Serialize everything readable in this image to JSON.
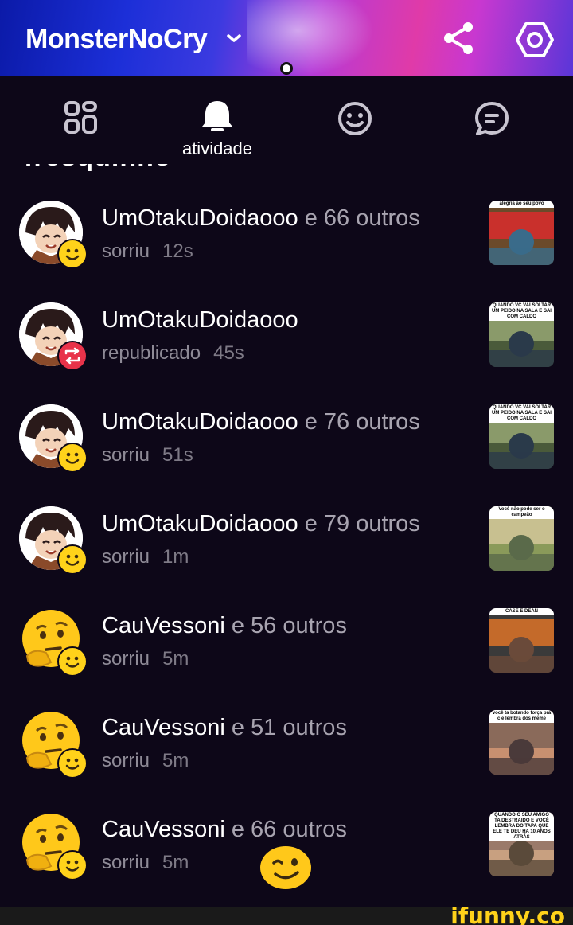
{
  "header": {
    "title": "MonsterNoCry",
    "chevron_icon": "chevron-down-icon",
    "share_icon": "share-icon",
    "settings_icon": "hexagon-settings-icon"
  },
  "tabs": [
    {
      "name": "tab-grid",
      "icon": "grid-icon",
      "label": ""
    },
    {
      "name": "tab-activity",
      "icon": "bell-icon",
      "label": "atividade"
    },
    {
      "name": "tab-smile",
      "icon": "smile-icon",
      "label": ""
    },
    {
      "name": "tab-chat",
      "icon": "chat-icon",
      "label": ""
    }
  ],
  "clipped_section_title": "fresquinho",
  "activity": [
    {
      "user": "UmOtakuDoidaooo",
      "others": " e 66 outros",
      "action": "sorriu",
      "time": "12s",
      "avatar": "anime",
      "badge": "smile",
      "thumb_caption": "alegria ao seu povo"
    },
    {
      "user": "UmOtakuDoidaooo",
      "others": "",
      "action": "republicado",
      "time": "45s",
      "avatar": "anime",
      "badge": "repost",
      "thumb_caption": "QUANDO VC VAI SOLTAR UM PEIDO NA SALA E SAI COM CALDO"
    },
    {
      "user": "UmOtakuDoidaooo",
      "others": " e 76 outros",
      "action": "sorriu",
      "time": "51s",
      "avatar": "anime",
      "badge": "smile",
      "thumb_caption": "QUANDO VC VAI SOLTAR UM PEIDO NA SALA E SAI COM CALDO"
    },
    {
      "user": "UmOtakuDoidaooo",
      "others": " e 79 outros",
      "action": "sorriu",
      "time": "1m",
      "avatar": "anime",
      "badge": "smile",
      "thumb_caption": "Você não pode ser o campeão"
    },
    {
      "user": "CauVessoni",
      "others": " e 56 outros",
      "action": "sorriu",
      "time": "5m",
      "avatar": "thinking",
      "badge": "smile",
      "thumb_caption": "CASE E DEAN"
    },
    {
      "user": "CauVessoni",
      "others": " e 51 outros",
      "action": "sorriu",
      "time": "5m",
      "avatar": "thinking",
      "badge": "smile",
      "thumb_caption": "você ta botando força pra c e lembra dos meme"
    },
    {
      "user": "CauVessoni",
      "others": " e 66 outros",
      "action": "sorriu",
      "time": "5m",
      "avatar": "thinking",
      "badge": "smile",
      "thumb_caption": "QUANDO O SEU AMIGO TA DESTRAIDO E VOCÊ LEMBRA DO TAPA QUE ELE TE DEU HA 10 ANOS ATRÁS"
    }
  ],
  "watermark": "ifunny.co",
  "colors": {
    "accent_yellow": "#ffd21a",
    "repost_red": "#e8334a",
    "background": "#0d0718"
  }
}
